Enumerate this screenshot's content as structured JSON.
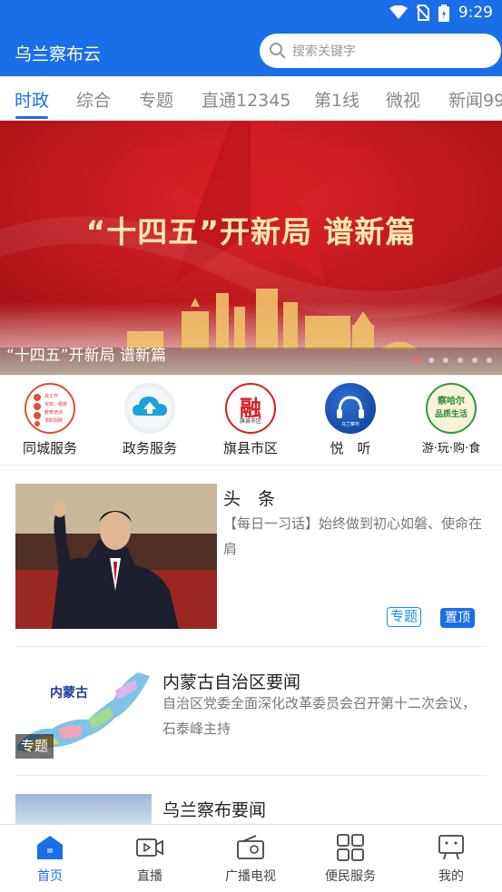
{
  "status_bar": {
    "time": "9:29"
  },
  "app_bar": {
    "title": "乌兰察布云",
    "search_placeholder": "搜索关键字"
  },
  "tabs": [
    "时政",
    "综合",
    "专题",
    "直通12345",
    "第1线",
    "微视",
    "新闻99"
  ],
  "active_tab": 0,
  "banner": {
    "headline": "“十四五”开新局 谱新篇",
    "caption": "“十四五”开新局 谱新篇",
    "slide_count": 6,
    "active_slide": 0
  },
  "services": [
    {
      "label": "同城服务",
      "icon": "city-service-icon",
      "badge_lines": [
        "找工作",
        "买房、租房",
        "教育培训",
        "求职招聘"
      ]
    },
    {
      "label": "政务服务",
      "icon": "cloud-upload-icon"
    },
    {
      "label": "旗县市区",
      "icon": "rong-logo-icon",
      "glyph": "融",
      "sub": "旗县市区"
    },
    {
      "label": "悦　听",
      "icon": "headphones-icon",
      "sub": "乌兰察布"
    },
    {
      "label": "游·玩·购·食",
      "icon": "lifestyle-icon",
      "glyph": "察哈尔",
      "sub": "品质生活"
    }
  ],
  "news": [
    {
      "title": "头　条",
      "summary": "【每日一习话】始终做到初心如磐、使命在肩",
      "tags": [
        "专题",
        "置顶"
      ]
    },
    {
      "title": "内蒙古自治区要闻",
      "summary": "自治区党委全面深化改革委员会召开第十二次会议，石泰峰主持",
      "thumb_title": "内蒙古",
      "thumb_label": "专题"
    },
    {
      "title": "乌兰察布要闻"
    }
  ],
  "bottom_nav": [
    {
      "label": "首页",
      "icon": "home-icon",
      "active": true
    },
    {
      "label": "直播",
      "icon": "live-video-icon"
    },
    {
      "label": "广播电视",
      "icon": "radio-tv-icon"
    },
    {
      "label": "便民服务",
      "icon": "grid-services-icon"
    },
    {
      "label": "我的",
      "icon": "profile-icon"
    }
  ],
  "colors": {
    "primary": "#1a6ee8",
    "banner_red": "#c0141b",
    "banner_gold": "#ffe9b0"
  }
}
